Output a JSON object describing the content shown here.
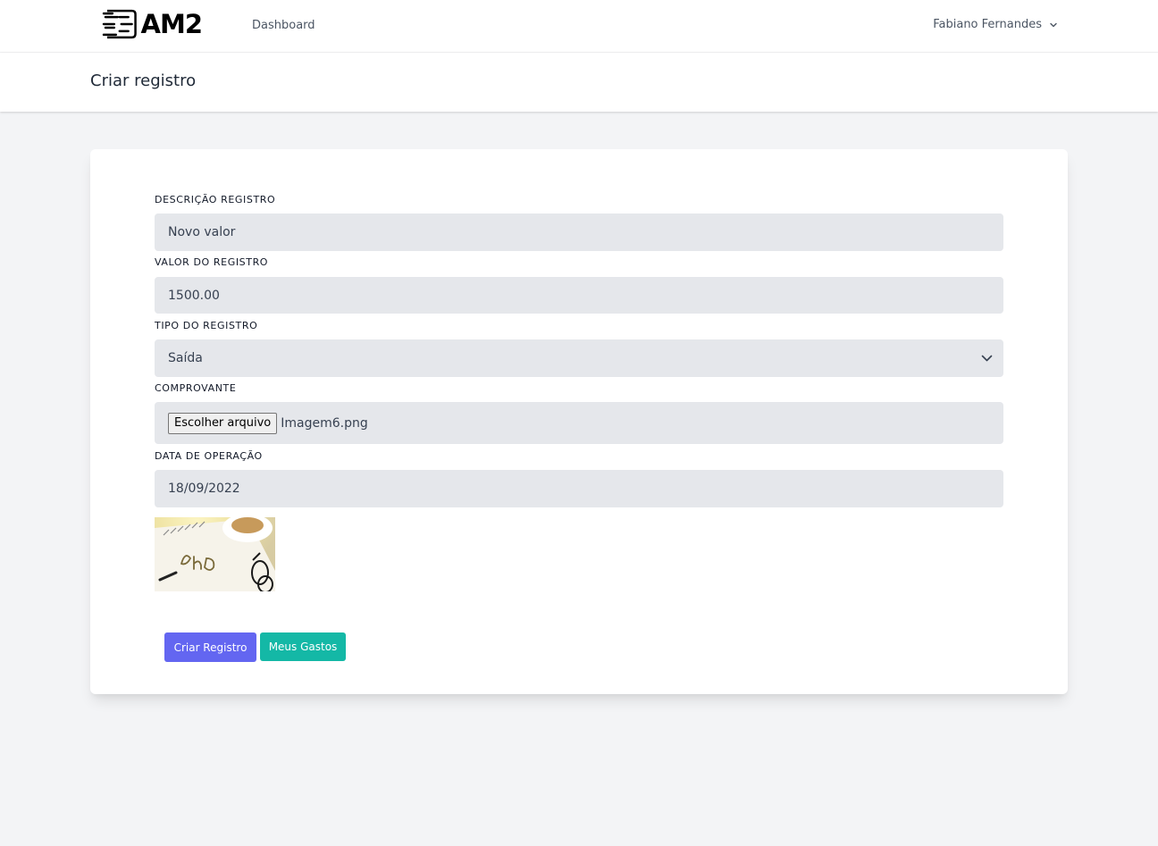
{
  "nav": {
    "logo_text": "AM2",
    "links": [
      "Dashboard"
    ],
    "user_name": "Fabiano Fernandes"
  },
  "header": {
    "title": "Criar registro"
  },
  "form": {
    "descricao": {
      "label": "Descrição registro",
      "value": "Novo valor"
    },
    "valor": {
      "label": "Valor do registro",
      "value": "1500.00"
    },
    "tipo": {
      "label": "Tipo do registro",
      "value": "Saída"
    },
    "comprovante": {
      "label": "Comprovante",
      "button_label": "Escolher arquivo",
      "file_name": "Imagem6.png"
    },
    "data": {
      "label": "Data de operação",
      "value": "18/09/2022"
    },
    "preview_image": "notebook-photo"
  },
  "actions": {
    "primary_label": "Criar Registro",
    "secondary_label": "Meus Gastos"
  },
  "colors": {
    "primary": "#6366f1",
    "secondary": "#14b8a6",
    "field_bg": "#e5e7eb",
    "page_bg": "#f3f4f6"
  }
}
